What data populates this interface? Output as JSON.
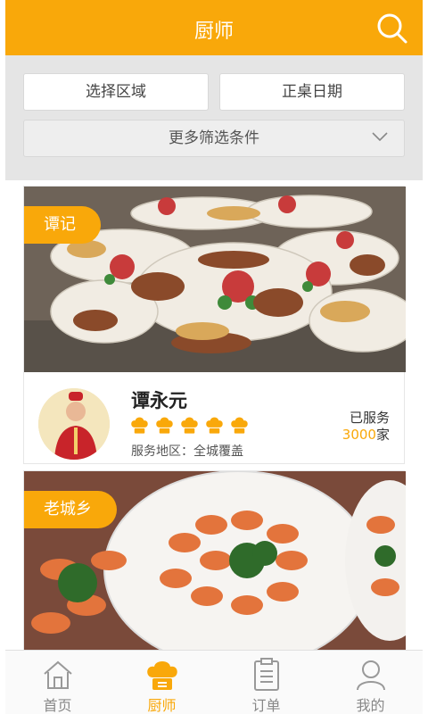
{
  "header": {
    "title": "厨师"
  },
  "filters": {
    "area_label": "选择区域",
    "date_label": "正桌日期",
    "more_label": "更多筛选条件"
  },
  "cards": [
    {
      "shop": "谭记",
      "chef_name": "谭永元",
      "rating_hats": 5,
      "service_area": "服务地区：全城覆盖",
      "served_prefix": "已服务",
      "served_count": "3000",
      "served_suffix": "家"
    },
    {
      "shop": "老城乡"
    }
  ],
  "tabbar": {
    "items": [
      {
        "label": "首页",
        "icon": "home-icon"
      },
      {
        "label": "厨师",
        "icon": "chef-hat-icon",
        "active": true
      },
      {
        "label": "订单",
        "icon": "order-list-icon"
      },
      {
        "label": "我的",
        "icon": "user-icon"
      }
    ]
  },
  "colors": {
    "accent": "#f9a80a",
    "background": "#e5e5e5"
  }
}
